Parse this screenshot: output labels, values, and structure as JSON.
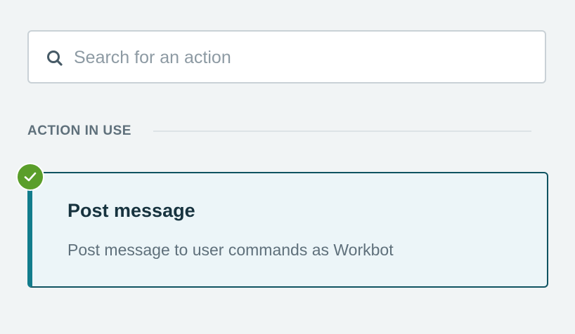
{
  "search": {
    "placeholder": "Search for an action",
    "icon": "search-icon",
    "value": ""
  },
  "section": {
    "title": "ACTION IN USE"
  },
  "action": {
    "title": "Post message",
    "description": "Post message to user commands as Workbot",
    "status_icon": "check-circle-icon",
    "status_color": "#5a9e2a",
    "accent_color": "#127c8c"
  }
}
